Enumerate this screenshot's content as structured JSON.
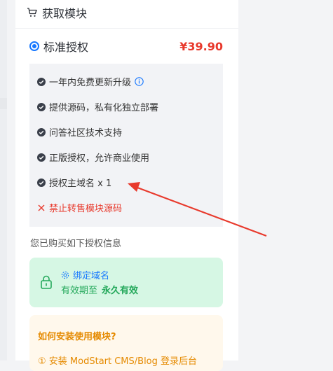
{
  "header": {
    "title": "获取模块",
    "icon": "cart-icon"
  },
  "plan": {
    "name": "标准授权",
    "price": "¥39.90",
    "selected": true
  },
  "features": [
    {
      "text": "一年内免费更新升级",
      "icon": "check-circle-icon",
      "has_info": true
    },
    {
      "text": "提供源码，私有化独立部署",
      "icon": "check-circle-icon"
    },
    {
      "text": "问答社区技术支持",
      "icon": "check-circle-icon"
    },
    {
      "text": "正版授权，允许商业使用",
      "icon": "check-circle-icon"
    },
    {
      "text": "授权主域名 x 1",
      "icon": "check-circle-icon"
    },
    {
      "text": "禁止转售模块源码",
      "icon": "close-icon"
    }
  ],
  "purchased_label": "您已购买如下授权信息",
  "license": {
    "bind_label": "绑定域名",
    "validity_label": "有效期至",
    "validity_value": "永久有效"
  },
  "install": {
    "title": "如何安装使用模块?",
    "step1": "① 安装 ModStart CMS/Blog 登录后台"
  },
  "colors": {
    "accent": "#1677ff",
    "price": "#e8392c",
    "success": "#23a85a",
    "warning": "#e58a00",
    "annotation_arrow": "#e8392c"
  }
}
